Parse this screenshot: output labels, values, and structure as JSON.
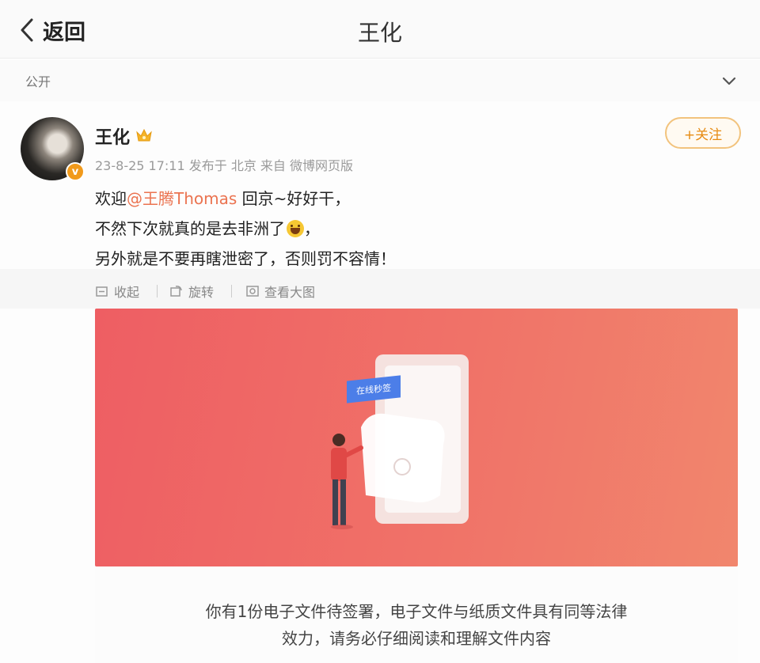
{
  "header": {
    "back_label": "返回",
    "title": "王化"
  },
  "visibility": {
    "label": "公开",
    "chevron_icon": "chevron-down-icon"
  },
  "post": {
    "user_name": "王化",
    "verified_icon": "v-badge-icon",
    "member_icon": "crown-icon",
    "meta": "23-8-25 17:11 发布于 北京 来自 微博网页版",
    "follow_label": "+关注",
    "text": {
      "line1_prefix": "欢迎",
      "mention": "@王腾Thomas",
      "line1_suffix": " 回京~好好干，",
      "line2": "不然下次就真的是去非洲了",
      "line2_end": "，",
      "line3": "另外就是不要再瞎泄密了，否则罚不容情！",
      "emoji": "laughing-emoji"
    },
    "tools": {
      "collapse_label": "收起",
      "rotate_label": "旋转",
      "view_large_label": "查看大图"
    },
    "image": {
      "tag_text": "在线秒签",
      "caption_line1": "你有1份电子文件待签署，电子文件与纸质文件具有同等法律",
      "caption_line2": "效力，请务必仔细阅读和理解文件内容"
    }
  },
  "colors": {
    "accent_orange": "#e78b12",
    "mention": "#eb7350",
    "banner_red": "#ee5e63",
    "tag_blue": "#4c7ee8"
  }
}
